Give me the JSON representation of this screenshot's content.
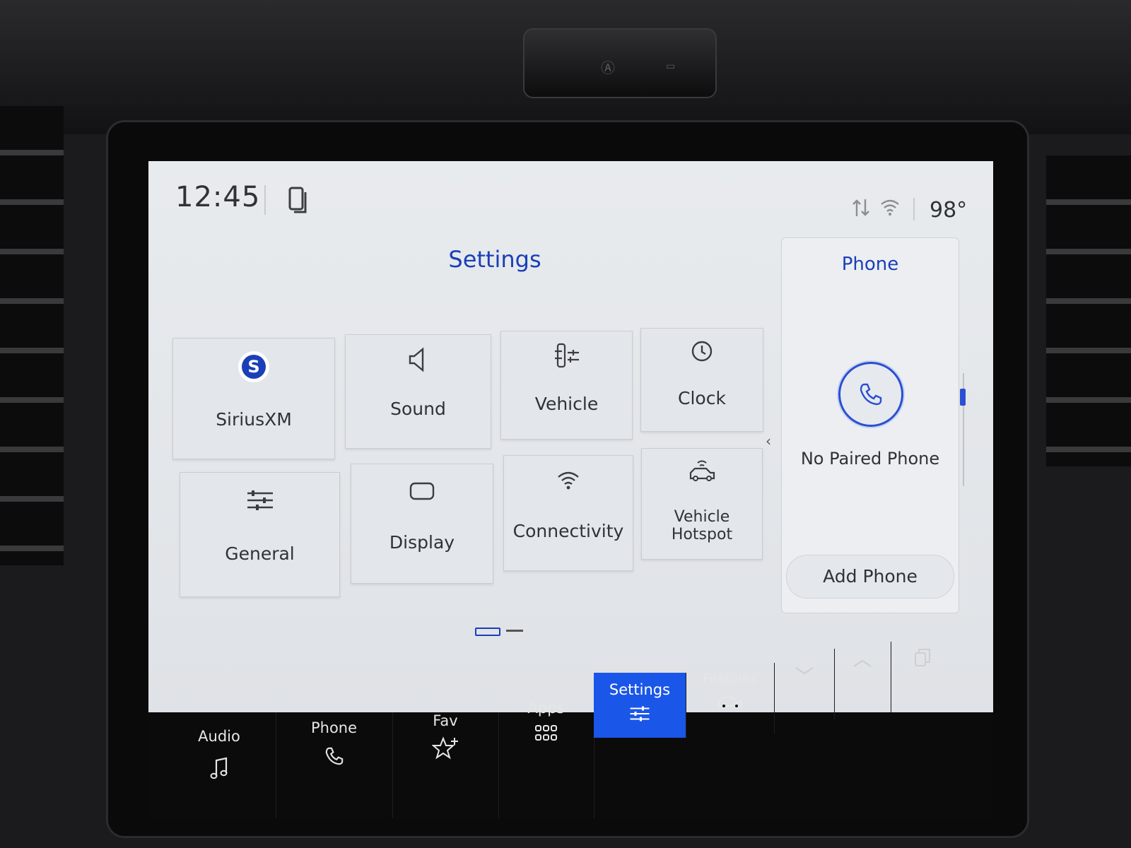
{
  "status": {
    "time": "12:45",
    "temperature": "98°"
  },
  "settings": {
    "title": "Settings",
    "tiles": [
      {
        "label": "SiriusXM",
        "icon": "siriusxm-logo-icon"
      },
      {
        "label": "Sound",
        "icon": "speaker-icon"
      },
      {
        "label": "Vehicle",
        "icon": "vehicle-settings-icon"
      },
      {
        "label": "Clock",
        "icon": "clock-icon"
      },
      {
        "label": "General",
        "icon": "sliders-icon"
      },
      {
        "label": "Display",
        "icon": "display-icon"
      },
      {
        "label": "Connectivity",
        "icon": "wifi-icon"
      },
      {
        "label": "Vehicle Hotspot",
        "icon": "vehicle-hotspot-icon"
      }
    ]
  },
  "phone_panel": {
    "title": "Phone",
    "status": "No Paired Phone",
    "add_button": "Add Phone"
  },
  "nav": {
    "items": [
      {
        "label": "Audio",
        "icon": "music-note-icon"
      },
      {
        "label": "Phone",
        "icon": "phone-icon"
      },
      {
        "label": "Fav",
        "icon": "star-plus-icon"
      },
      {
        "label": "Apps",
        "icon": "grid-icon"
      },
      {
        "label": "Settings",
        "icon": "sliders-icon",
        "active": true
      },
      {
        "label": "Features",
        "icon": "truck-icon"
      }
    ],
    "controls": [
      "chevron-down-icon",
      "chevron-up-icon",
      "copy-windows-icon"
    ]
  },
  "colors": {
    "accent": "#1a56e8",
    "title_blue": "#1a3fb8",
    "screen_bg": "#e3e6ea",
    "nav_bg": "#0b0b0c"
  }
}
